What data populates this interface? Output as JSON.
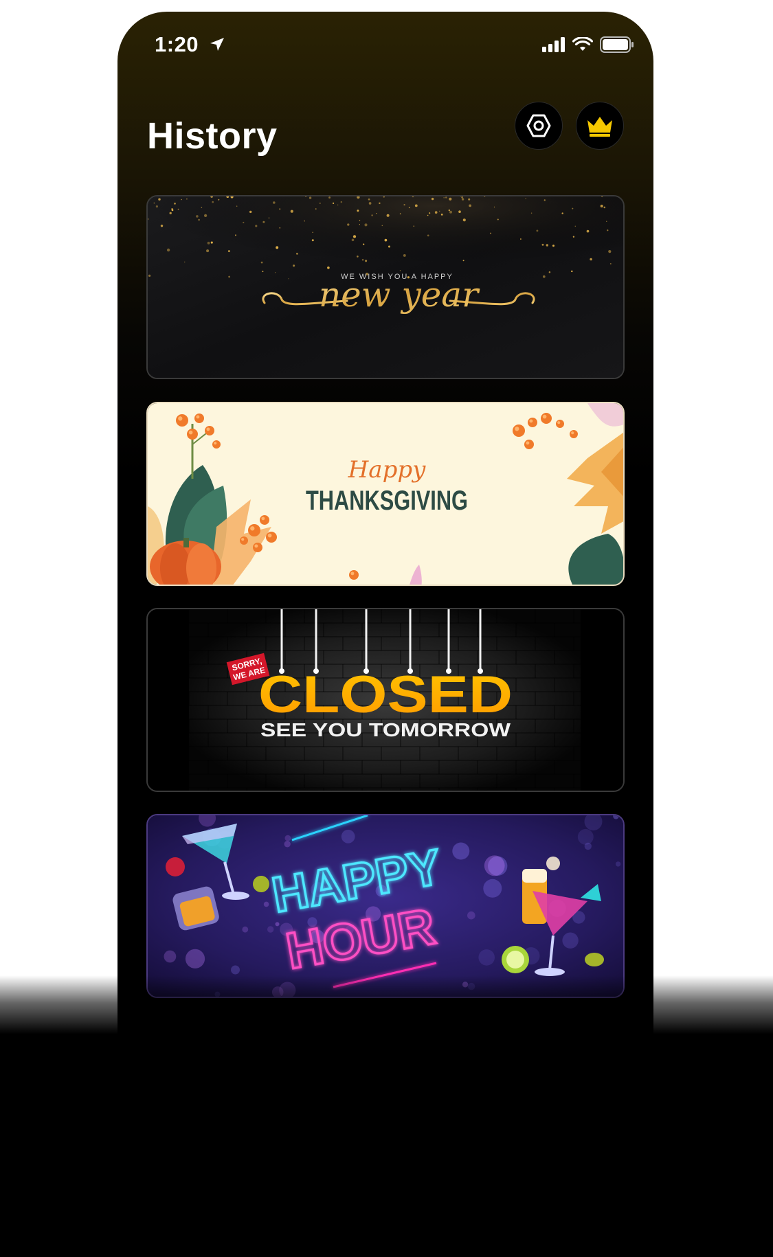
{
  "status_bar": {
    "time": "1:20",
    "icons": [
      "location-arrow-icon",
      "signal-icon",
      "wifi-icon",
      "battery-icon"
    ]
  },
  "header": {
    "title": "History",
    "settings_icon": "hexagon-settings-icon",
    "premium_icon": "crown-icon"
  },
  "cards": [
    {
      "theme": "new-year",
      "line_1": "WE WISH YOU A HAPPY",
      "line_2": "new year"
    },
    {
      "theme": "thanksgiving",
      "line_1": "Happy",
      "line_2": "THANKSGIVING"
    },
    {
      "theme": "closed",
      "badge_line_1": "SORRY,",
      "badge_line_2": "WE ARE",
      "line_1": "CLOSED",
      "line_2": "SEE YOU TOMORROW"
    },
    {
      "theme": "happy-hour",
      "line_1": "HAPPY",
      "line_2": "HOUR"
    }
  ],
  "colors": {
    "accent_gold": "#f5c800",
    "header_gradient_top": "#2a2204",
    "background": "#000000"
  }
}
